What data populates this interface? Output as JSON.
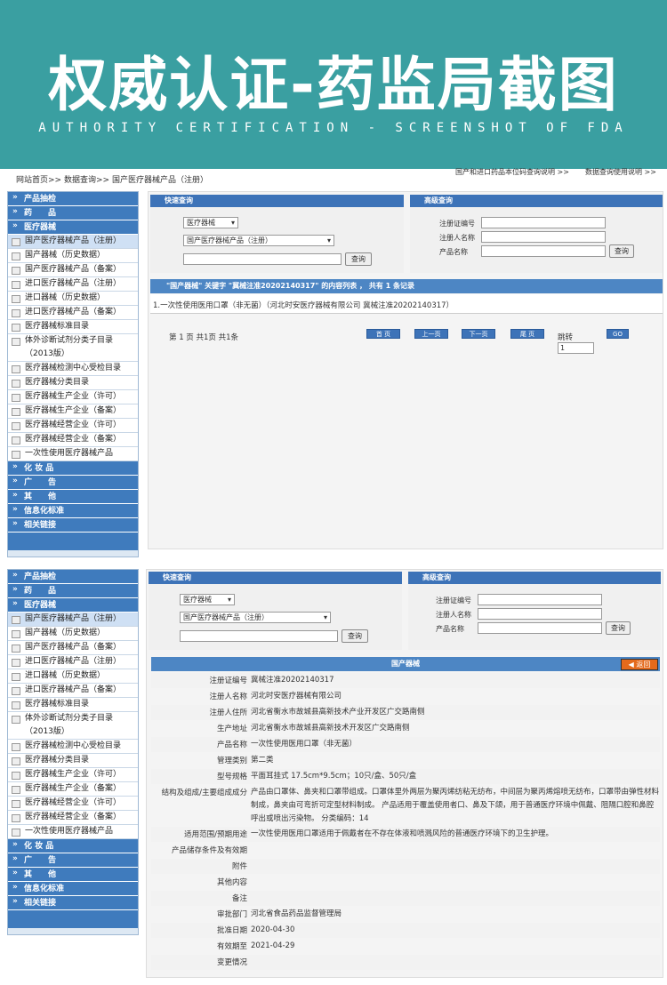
{
  "banner": {
    "title": "权威认证-药监局截图",
    "subtitle": "AUTHORITY CERTIFICATION - SCREENSHOT OF FDA"
  },
  "breadcrumb": {
    "home": "网站首页",
    "sep1": ">>",
    "data_query": "数据查询",
    "sep2": ">>",
    "current": "国产医疗器械产品（注册）"
  },
  "top_links": {
    "link1": "国产和进口药品本位码查询说明 >>",
    "link2": "数据查询使用说明 >>"
  },
  "sidebar": {
    "cat_top": [
      "产品抽检",
      "药　　品",
      "医疗器械"
    ],
    "items": [
      "国产医疗器械产品（注册）",
      "国产器械（历史数据）",
      "国产医疗器械产品（备案）",
      "进口医疗器械产品（注册）",
      "进口器械（历史数据）",
      "进口医疗器械产品（备案）",
      "医疗器械标准目录",
      "体外诊断试剂分类子目录（2013版）",
      "医疗器械检测中心受检目录",
      "医疗器械分类目录",
      "医疗器械生产企业（许可）",
      "医疗器械生产企业（备案）",
      "医疗器械经营企业（许可）",
      "医疗器械经营企业（备案）",
      "一次性使用医疗器械产品"
    ],
    "cat_bottom": [
      "化 妆 品",
      "广　　告",
      "其　　他",
      "信息化标准",
      "相关链接"
    ]
  },
  "quick_search": {
    "title": "快速查询",
    "select1": "医疗器械",
    "select2": "国产医疗器械产品（注册）",
    "button": "查询"
  },
  "advanced_search": {
    "title": "高级查询",
    "label_reg": "注册证编号",
    "label_name": "注册人名称",
    "label_product": "产品名称",
    "button": "查询"
  },
  "results": {
    "header": "\"国产器械\" 关键字 \"冀械注准20202140317\" 的内容列表 ，  共有 1 条记录",
    "item": "1.一次性使用医用口罩（非无菌）（河北时安医疗器械有限公司 冀械注准20202140317）",
    "page_info": "第 1 页 共1页 共1条",
    "first": "首 页",
    "prev": "上一页",
    "next": "下一页",
    "last": "尾 页",
    "jump_label": "跳转",
    "jump_value": "1",
    "go": "GO"
  },
  "detail": {
    "title": "国产器械",
    "back": "返回",
    "rows": [
      {
        "k": "注册证编号",
        "v": "冀械注准20202140317"
      },
      {
        "k": "注册人名称",
        "v": "河北时安医疗器械有限公司"
      },
      {
        "k": "注册人住所",
        "v": "河北省衡水市故城县高新技术产业开发区广交路南侧"
      },
      {
        "k": "生产地址",
        "v": "河北省衡水市故城县高新技术开发区广交路南侧"
      },
      {
        "k": "产品名称",
        "v": "一次性使用医用口罩（非无菌）"
      },
      {
        "k": "管理类别",
        "v": "第二类"
      },
      {
        "k": "型号规格",
        "v": "平面耳挂式 17.5cm*9.5cm；10只/盒、50只/盒"
      },
      {
        "k": "结构及组成/主要组成成分",
        "v": "产品由口罩体、鼻夹和口罩带组成。口罩体里外两层为聚丙烯纺粘无纺布，中间层为聚丙烯熔喷无纺布，口罩带由弹性材料制成，鼻夹由可弯折可定型材料制成。 产品适用于覆盖使用者口、鼻及下颌，用于普通医疗环境中佩戴、阻隔口腔和鼻腔呼出或喷出污染物。 分类编码：14"
      },
      {
        "k": "适用范围/预期用途",
        "v": "一次性使用医用口罩适用于佩戴者在不存在体液和喷溅风险的普通医疗环境下的卫生护理。"
      },
      {
        "k": "产品储存条件及有效期",
        "v": ""
      },
      {
        "k": "附件",
        "v": ""
      },
      {
        "k": "其他内容",
        "v": ""
      },
      {
        "k": "备注",
        "v": ""
      },
      {
        "k": "审批部门",
        "v": "河北省食品药品监督管理局"
      },
      {
        "k": "批准日期",
        "v": "2020-04-30"
      },
      {
        "k": "有效期至",
        "v": "2021-04-29"
      },
      {
        "k": "变更情况",
        "v": ""
      }
    ]
  },
  "colors": {
    "banner": "#3a9fa1",
    "header_blue": "#3d73b8",
    "back_button": "#e46a1c"
  }
}
